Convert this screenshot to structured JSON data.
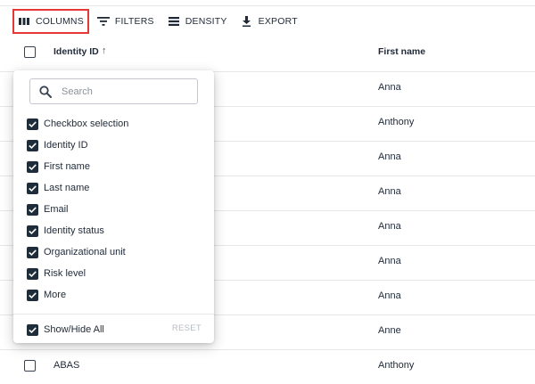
{
  "toolbar": {
    "columns_label": "COLUMNS",
    "filters_label": "FILTERS",
    "density_label": "DENSITY",
    "export_label": "EXPORT"
  },
  "table": {
    "headers": {
      "identity_id": "Identity ID",
      "first_name": "First name"
    },
    "sort_indicator": "↑",
    "rows": [
      {
        "first_name": "Anna"
      },
      {
        "first_name": "Anthony"
      },
      {
        "first_name": "Anna"
      },
      {
        "first_name": "Anna"
      },
      {
        "first_name": "Anna"
      },
      {
        "first_name": "Anna"
      },
      {
        "first_name": "Anna"
      },
      {
        "first_name": "Anne"
      },
      {
        "identity_id": "ABAS",
        "first_name": "Anthony"
      }
    ]
  },
  "columns_panel": {
    "search_placeholder": "Search",
    "options": [
      {
        "label": "Checkbox selection",
        "checked": true
      },
      {
        "label": "Identity ID",
        "checked": true
      },
      {
        "label": "First name",
        "checked": true
      },
      {
        "label": "Last name",
        "checked": true
      },
      {
        "label": "Email",
        "checked": true
      },
      {
        "label": "Identity status",
        "checked": true
      },
      {
        "label": "Organizational unit",
        "checked": true
      },
      {
        "label": "Risk level",
        "checked": true
      },
      {
        "label": "More",
        "checked": true
      }
    ],
    "show_hide_all_label": "Show/Hide All",
    "reset_label": "RESET"
  },
  "colors": {
    "highlight": "#e53935",
    "checkbox": "#1f2d3a"
  }
}
